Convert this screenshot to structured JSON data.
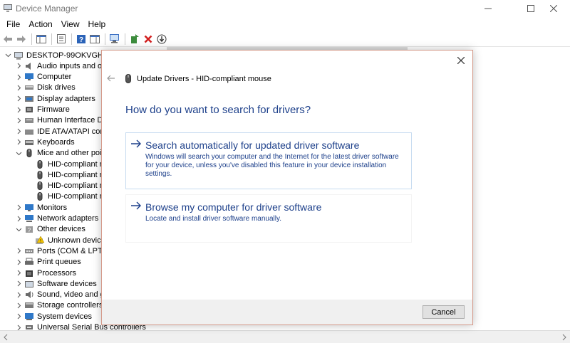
{
  "window": {
    "title": "Device Manager"
  },
  "menu": {
    "items": [
      "File",
      "Action",
      "View",
      "Help"
    ]
  },
  "toolbar": {
    "icons": [
      "back-icon",
      "forward-icon",
      "properties-icon",
      "help-icon",
      "driver-icon",
      "scan-icon",
      "update-driver-icon",
      "uninstall-icon",
      "download-icon"
    ]
  },
  "tree": {
    "rows": [
      {
        "label": "DESKTOP-99OKVGH",
        "chevron": "down",
        "icon": "computer-root-icon",
        "depth": 0
      },
      {
        "label": "Audio inputs and ou",
        "chevron": "right",
        "icon": "audio-icon",
        "depth": 1
      },
      {
        "label": "Computer",
        "chevron": "right",
        "icon": "monitor-icon",
        "depth": 1
      },
      {
        "label": "Disk drives",
        "chevron": "right",
        "icon": "disk-icon",
        "depth": 1
      },
      {
        "label": "Display adapters",
        "chevron": "right",
        "icon": "display-adapter-icon",
        "depth": 1
      },
      {
        "label": "Firmware",
        "chevron": "right",
        "icon": "firmware-icon",
        "depth": 1
      },
      {
        "label": "Human Interface De",
        "chevron": "right",
        "icon": "hid-icon",
        "depth": 1
      },
      {
        "label": "IDE ATA/ATAPI contr",
        "chevron": "right",
        "icon": "ide-icon",
        "depth": 1
      },
      {
        "label": "Keyboards",
        "chevron": "right",
        "icon": "keyboard-icon",
        "depth": 1
      },
      {
        "label": "Mice and other poin",
        "chevron": "down",
        "icon": "mouse-icon",
        "depth": 1
      },
      {
        "label": "HID-compliant n",
        "chevron": "",
        "icon": "mouse-icon",
        "depth": 2
      },
      {
        "label": "HID-compliant n",
        "chevron": "",
        "icon": "mouse-icon",
        "depth": 2
      },
      {
        "label": "HID-compliant n",
        "chevron": "",
        "icon": "mouse-icon",
        "depth": 2
      },
      {
        "label": "HID-compliant n",
        "chevron": "",
        "icon": "mouse-icon",
        "depth": 2
      },
      {
        "label": "Monitors",
        "chevron": "right",
        "icon": "monitor-icon",
        "depth": 1
      },
      {
        "label": "Network adapters",
        "chevron": "right",
        "icon": "network-icon",
        "depth": 1
      },
      {
        "label": "Other devices",
        "chevron": "down",
        "icon": "other-devices-icon",
        "depth": 1
      },
      {
        "label": "Unknown device",
        "chevron": "",
        "icon": "unknown-device-icon",
        "depth": 2
      },
      {
        "label": "Ports (COM & LPT)",
        "chevron": "right",
        "icon": "port-icon",
        "depth": 1
      },
      {
        "label": "Print queues",
        "chevron": "right",
        "icon": "printer-icon",
        "depth": 1
      },
      {
        "label": "Processors",
        "chevron": "right",
        "icon": "processor-icon",
        "depth": 1
      },
      {
        "label": "Software devices",
        "chevron": "right",
        "icon": "software-icon",
        "depth": 1
      },
      {
        "label": "Sound, video and ga",
        "chevron": "right",
        "icon": "sound-icon",
        "depth": 1
      },
      {
        "label": "Storage controllers",
        "chevron": "right",
        "icon": "storage-icon",
        "depth": 1
      },
      {
        "label": "System devices",
        "chevron": "right",
        "icon": "system-icon",
        "depth": 1
      },
      {
        "label": "Universal Serial Bus controllers",
        "chevron": "right",
        "icon": "usb-icon",
        "depth": 1
      }
    ]
  },
  "dialog": {
    "header_title": "Update Drivers - HID-compliant mouse",
    "question": "How do you want to search for drivers?",
    "option_auto": {
      "title": "Search automatically for updated driver software",
      "description": "Windows will search your computer and the Internet for the latest driver software for your device, unless you've disabled this feature in your device installation settings."
    },
    "option_browse": {
      "title": "Browse my computer for driver software",
      "description": "Locate and install driver software manually."
    },
    "cancel_label": "Cancel"
  },
  "colors": {
    "link_blue": "#1c3f8a",
    "dialog_border": "#d49a8a",
    "option_border": "#c7dbf0"
  }
}
